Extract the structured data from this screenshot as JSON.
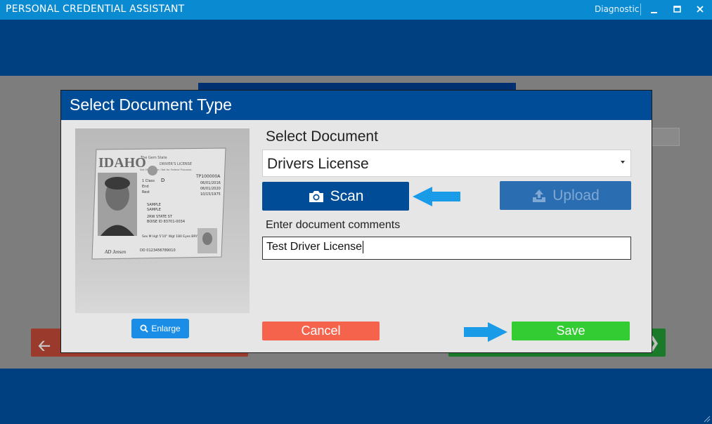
{
  "window": {
    "title": "PERSONAL CREDENTIAL ASSISTANT",
    "diagnostic_label": "Diagnostic",
    "controls": [
      "minimize-icon",
      "maximize-icon",
      "close-icon"
    ]
  },
  "modal": {
    "title": "Select Document Type",
    "preview": {
      "state_label": "IDAHO",
      "state_sub": "The Gem State",
      "doc_heading": "DRIVER'S LICENSE",
      "doc_sub": "Not Official Use / Not for Federal Purposes",
      "license_no": "TP100000A",
      "class_label": "1 Class",
      "class_value": "D",
      "end_label": "End",
      "rest_label": "Rest",
      "dates": [
        "06/01/2016",
        "06/01/2020",
        "10/15/1975"
      ],
      "name_lines": [
        "SAMPLE",
        "SAMPLE"
      ],
      "address_lines": [
        "2RW STATE ST",
        "BOISE ID 83701-0034"
      ],
      "stats": "Sex M  Hgt 5'10\"  Wgt 180  Eyes BRY  Hair UNK",
      "signature": "AD Jensen",
      "dd_number": "DD 0123456789010"
    },
    "enlarge_label": "Enlarge",
    "select_label": "Select Document",
    "select_value": "Drivers License",
    "scan_label": "Scan",
    "upload_label": "Upload",
    "comments_label": "Enter document comments",
    "comments_value": "Test Driver License",
    "cancel_label": "Cancel",
    "save_label": "Save"
  },
  "colors": {
    "titlebar": "#0a8ad0",
    "app_blue": "#004080",
    "modal_header": "#004c97",
    "cancel": "#f6634d",
    "save": "#33cc33",
    "pointer_arrow": "#1a9be8"
  }
}
